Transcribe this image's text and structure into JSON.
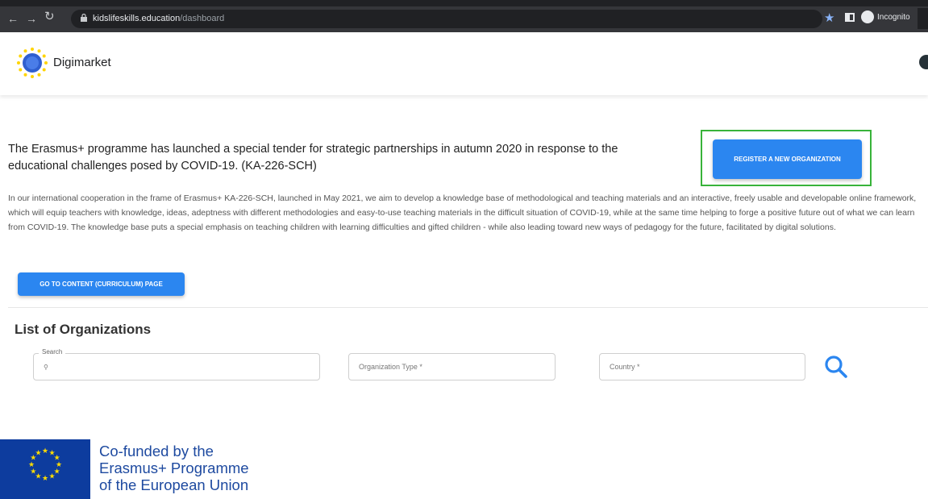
{
  "browser": {
    "url_domain": "kidslifeskills.education",
    "url_path": "/dashboard",
    "incognito_label": "Incognito"
  },
  "header": {
    "brand": "Digimarket"
  },
  "main": {
    "headline": "The Erasmus+ programme has launched a special tender for strategic partnerships in autumn 2020 in response to the educational challenges posed by COVID-19. (KA-226-SCH)",
    "register_button": "REGISTER A NEW ORGANIZATION",
    "description": "In our international cooperation in the frame of Erasmus+ KA-226-SCH, launched in May 2021, we aim to develop a knowledge base of methodological and teaching materials and an interactive, freely usable and developable online framework, which will equip teachers with knowledge, ideas, adeptness with different methodologies and easy-to-use teaching materials in the difficult situation of COVID-19, while at the same time helping to forge a positive future out of what we can learn from COVID-19. The knowledge base puts a special emphasis on teaching children with learning difficulties and gifted children - while also leading toward new ways of pedagogy for the future, facilitated by digital solutions.",
    "content_button": "GO TO CONTENT (CURRICULUM) PAGE",
    "list_title": "List of Organizations"
  },
  "filters": {
    "search_label": "Search",
    "organization_type_placeholder": "Organization Type *",
    "country_placeholder": "Country *"
  },
  "footer": {
    "eu_line1": "Co-funded by the",
    "eu_line2": "Erasmus+ Programme",
    "eu_line3": "of the European Union"
  },
  "colors": {
    "primary_button": "#2b86f0",
    "highlight_border": "#38b33a",
    "eu_blue": "#0d3c9e",
    "eu_star": "#ffdd00"
  }
}
